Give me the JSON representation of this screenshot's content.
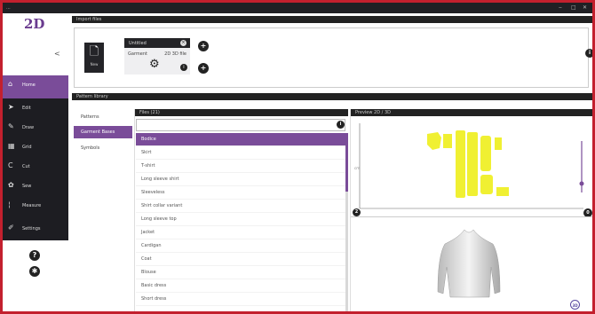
{
  "titlebar": {
    "title": "...",
    "minimize": "‒",
    "maximize": "□",
    "close": "✕"
  },
  "brand": {
    "logo": "2D",
    "collapse": "<"
  },
  "nav": {
    "items": [
      {
        "label": "Home",
        "icon": "home-icon",
        "glyph": "⌂"
      },
      {
        "label": "Edit",
        "icon": "cursor-icon",
        "glyph": "➤"
      },
      {
        "label": "Draw",
        "icon": "pencil-icon",
        "glyph": "✎"
      },
      {
        "label": "Grid",
        "icon": "grid-icon",
        "glyph": "▦"
      },
      {
        "label": "Cut",
        "icon": "curve-icon",
        "glyph": "C"
      },
      {
        "label": "Sew",
        "icon": "shirt-icon",
        "glyph": "✿"
      },
      {
        "label": "Measure",
        "icon": "ruler-icon",
        "glyph": "¦"
      },
      {
        "label": "Settings",
        "icon": "wrench-icon",
        "glyph": "✐"
      }
    ],
    "help": "?",
    "settings_glyph": "✱"
  },
  "import_section": {
    "title": "Import files",
    "new_label": "New",
    "card": {
      "name": "Untitled",
      "left": "Garment",
      "right": "2D 3D file",
      "close": "×",
      "info": "i"
    },
    "plus1": "+",
    "plus2": "+",
    "right_badge": "i"
  },
  "library_section": {
    "title": "Pattern library"
  },
  "subcategories": [
    "Patterns",
    "Garment Bases",
    "Symbols"
  ],
  "list": {
    "header": "Files (21)",
    "search_value": "",
    "search_placeholder": "",
    "info": "i",
    "items": [
      "Bodice",
      "Skirt",
      "T-shirt",
      "Long sleeve shirt",
      "Sleeveless",
      "Shirt collar variant",
      "Long sleeve top",
      "Jacket",
      "Cardigan",
      "Coat",
      "Blouse",
      "Basic dress",
      "Short dress"
    ]
  },
  "preview": {
    "header": "Preview 2D / 3D",
    "badge_l": "2",
    "badge_r": "0",
    "badge_bottom": "3D",
    "axis_x_label": "cm",
    "axis_y_label": "cm"
  },
  "colors": {
    "accent": "#7a4c99",
    "frame": "#c3202e",
    "pattern": "#f0f032",
    "sidebar": "#1d1d22"
  }
}
